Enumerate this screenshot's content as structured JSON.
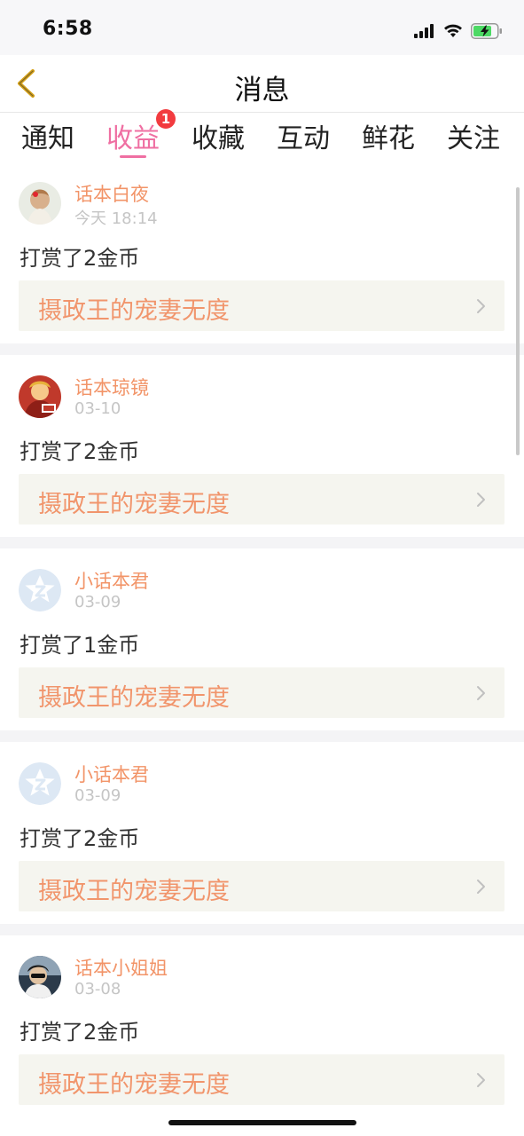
{
  "status_bar": {
    "time": "6:58"
  },
  "nav": {
    "title": "消息",
    "back_icon": "chevron-left-icon",
    "accent": "#d4a017"
  },
  "tabs": [
    {
      "label": "通知",
      "active": false
    },
    {
      "label": "收益",
      "active": true,
      "badge": "1"
    },
    {
      "label": "收藏",
      "active": false
    },
    {
      "label": "互动",
      "active": false
    },
    {
      "label": "鲜花",
      "active": false
    },
    {
      "label": "关注",
      "active": false
    }
  ],
  "messages": [
    {
      "user": "话本白夜",
      "time": "今天 18:14",
      "text": "打赏了2金币",
      "book": "摄政王的宠妻无度"
    },
    {
      "user": "话本琼镜",
      "time": "03-10",
      "text": "打赏了2金币",
      "book": "摄政王的宠妻无度"
    },
    {
      "user": "小话本君",
      "time": "03-09",
      "text": "打赏了1金币",
      "book": "摄政王的宠妻无度"
    },
    {
      "user": "小话本君",
      "time": "03-09",
      "text": "打赏了2金币",
      "book": "摄政王的宠妻无度"
    },
    {
      "user": "话本小姐姐",
      "time": "03-08",
      "text": "打赏了2金币",
      "book": "摄政王的宠妻无度"
    }
  ],
  "colors": {
    "active_tab": "#ef6fa2",
    "username": "#f29468",
    "book_title": "#f1956c",
    "badge": "#f23b3f"
  }
}
